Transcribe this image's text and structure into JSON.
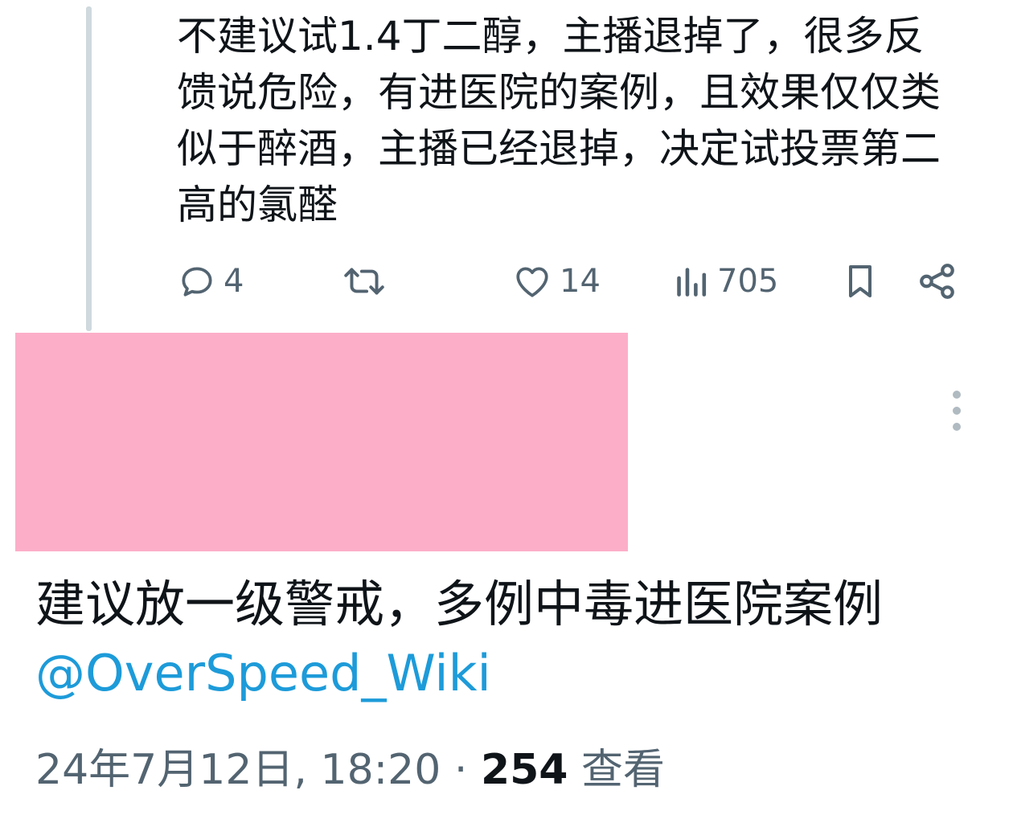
{
  "reply": {
    "text": "不建议试1.4丁二醇，主播退掉了，很多反\n馈说危险，有进医院的案例，且效果仅仅类\n似于醉酒，主播已经退掉，决定试投票第二\n高的氯醛",
    "actions": {
      "reply_count": "4",
      "retweet_count": "",
      "like_count": "14",
      "views_count": "705"
    }
  },
  "icons": [
    "reply-icon",
    "retweet-icon",
    "like-icon",
    "views-icon",
    "bookmark-icon",
    "share-icon",
    "more-icon"
  ],
  "redacted_color": "#fcaec8",
  "tweet": {
    "text": "建议放一级警戒，多例中毒进医院案例",
    "mention": "@OverSpeed_Wiki",
    "timestamp": "24年7月12日, 18:20",
    "separator": " · ",
    "views_count": "254",
    "views_label": "查看"
  },
  "colors": {
    "text": "#0f1419",
    "secondary": "#536471",
    "link": "#1d9bd9"
  }
}
